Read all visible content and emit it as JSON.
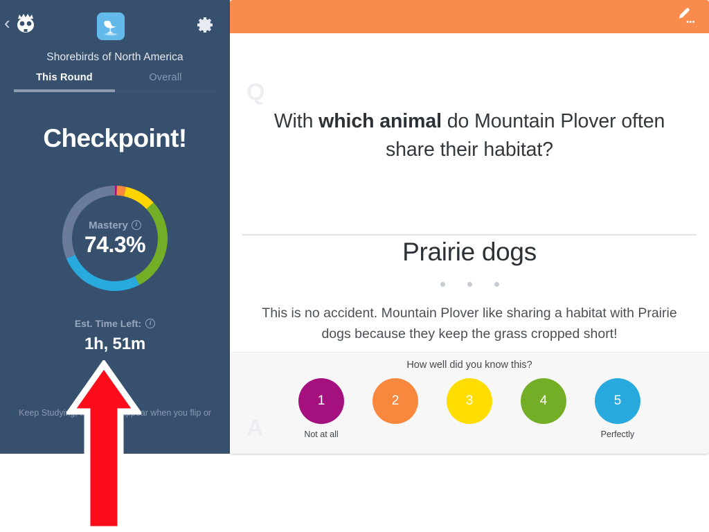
{
  "sidebar": {
    "back_label": "‹",
    "logo_icon": "owl-logo-icon",
    "deck_icon": "shorebird-icon",
    "settings_icon": "gear-icon",
    "deck_title": "Shorebirds of North America",
    "tabs": [
      {
        "label": "This Round",
        "active": true
      },
      {
        "label": "Overall",
        "active": false
      }
    ],
    "heading": "Checkpoint!",
    "mastery": {
      "label": "Mastery",
      "info_icon": "info-icon",
      "value": "74.3%"
    },
    "time": {
      "label": "Est. Time Left:",
      "info_icon": "info-icon",
      "value": "1h, 51m"
    },
    "footer_note": "Keep Studying, this will disappear when you flip or"
  },
  "chart_data": {
    "type": "pie",
    "title": "Mastery",
    "center_value": "74.3%",
    "legend": "none",
    "donut": true,
    "categories": [
      "Level 1",
      "Level 2",
      "Level 3",
      "Level 4",
      "Level 5",
      "Unseen"
    ],
    "values": [
      0.6,
      2.8,
      9.7,
      29.2,
      26.4,
      31.3
    ],
    "colors": [
      "#A5107F",
      "#F9883F",
      "#FFD500",
      "#74AD26",
      "#29AADF",
      "#6A7C99"
    ],
    "start_angle": -90
  },
  "card": {
    "header": {
      "edit_icon": "pencil-edit-icon"
    },
    "question_marker": "Q",
    "answer_marker": "A",
    "question": {
      "prefix": "With ",
      "bold": "which animal",
      "suffix": " do Mountain Plover often share their habitat?"
    },
    "answer": "Prairie dogs",
    "explanation": "This is no accident. Mountain Plover like sharing a habitat with Prairie dogs because they keep the grass cropped short!",
    "rating": {
      "prompt": "How well did you know this?",
      "options": [
        {
          "value": "1",
          "color": "#A5107F",
          "caption": "Not at all"
        },
        {
          "value": "2",
          "color": "#F9883F",
          "caption": ""
        },
        {
          "value": "3",
          "color": "#FFDD00",
          "caption": ""
        },
        {
          "value": "4",
          "color": "#74AD26",
          "caption": ""
        },
        {
          "value": "5",
          "color": "#29AADF",
          "caption": "Perfectly"
        }
      ]
    }
  },
  "overlay": {
    "arrow": "red-up-arrow-annotation"
  },
  "colors": {
    "sidebar_bg": "#37506E",
    "card_header_orange": "#F98B4D",
    "accent_blue": "#64B9EB",
    "arrow_red": "#FC0D1B"
  }
}
